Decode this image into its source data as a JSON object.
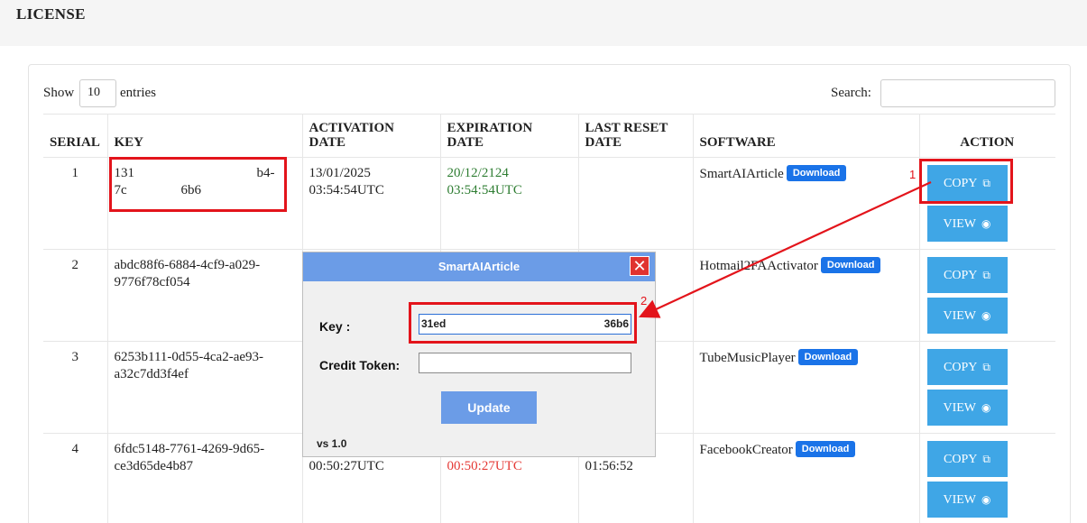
{
  "page": {
    "title": "LICENSE"
  },
  "controls": {
    "show_label": "Show",
    "entries_value": "10",
    "entries_label": "entries",
    "search_label": "Search:",
    "search_value": ""
  },
  "table": {
    "headers": {
      "serial": "SERIAL",
      "key": "KEY",
      "activation": "ACTIVATION DATE",
      "expiration": "EXPIRATION DATE",
      "last_reset_1": "LAST RESET",
      "last_reset_2": "DATE",
      "software": "SOFTWARE",
      "action": "ACTION"
    },
    "rows": [
      {
        "serial": "1",
        "key_a": "131",
        "key_b": "b4-",
        "key_c": "7c",
        "key_d": "6b6",
        "activation_1": "13/01/2025",
        "activation_2": "03:54:54UTC",
        "expiration_1": "20/12/2124",
        "expiration_2": "03:54:54UTC",
        "last_reset": "",
        "software": "SmartAIArticle",
        "download": "Download",
        "copy": "COPY",
        "view": "VIEW"
      },
      {
        "serial": "2",
        "key_1": "abdc88f6-6884-4cf9-a029-",
        "key_2": "9776f78cf054",
        "software": "Hotmail2FAActivator",
        "download": "Download",
        "copy": "COPY",
        "view": "VIEW"
      },
      {
        "serial": "3",
        "key_1": "6253b111-0d55-4ca2-ae93-",
        "key_2": "a32c7dd3f4ef",
        "software": "TubeMusicPlayer",
        "download": "Download",
        "copy": "COPY",
        "view": "VIEW"
      },
      {
        "serial": "4",
        "key_1": "6fdc5148-7761-4269-9d65-",
        "key_2": "ce3d65de4b87",
        "activation_2": "00:50:27UTC",
        "expiration_2": "00:50:27UTC",
        "last_reset": "01:56:52",
        "software": "FacebookCreator",
        "download": "Download",
        "copy": "COPY",
        "view": "VIEW"
      }
    ]
  },
  "dialog": {
    "title": "SmartAIArticle",
    "close": "✕",
    "key_label": "Key :",
    "key_value_start": "31ed",
    "key_value_end": "36b6",
    "credit_label": "Credit Token:",
    "update": "Update",
    "version": "vs 1.0"
  },
  "annotations": {
    "one": "1",
    "two": "2"
  },
  "colors": {
    "copy_button": "#3fa6e6",
    "download_badge": "#1a73e8",
    "dialog_title": "#6b9ce7",
    "annotation": "#e3141b",
    "expiry_green": "#2e7d32",
    "expiry_red": "#e53935"
  },
  "icons": {
    "copy": "copy-icon",
    "view": "eye-icon"
  }
}
